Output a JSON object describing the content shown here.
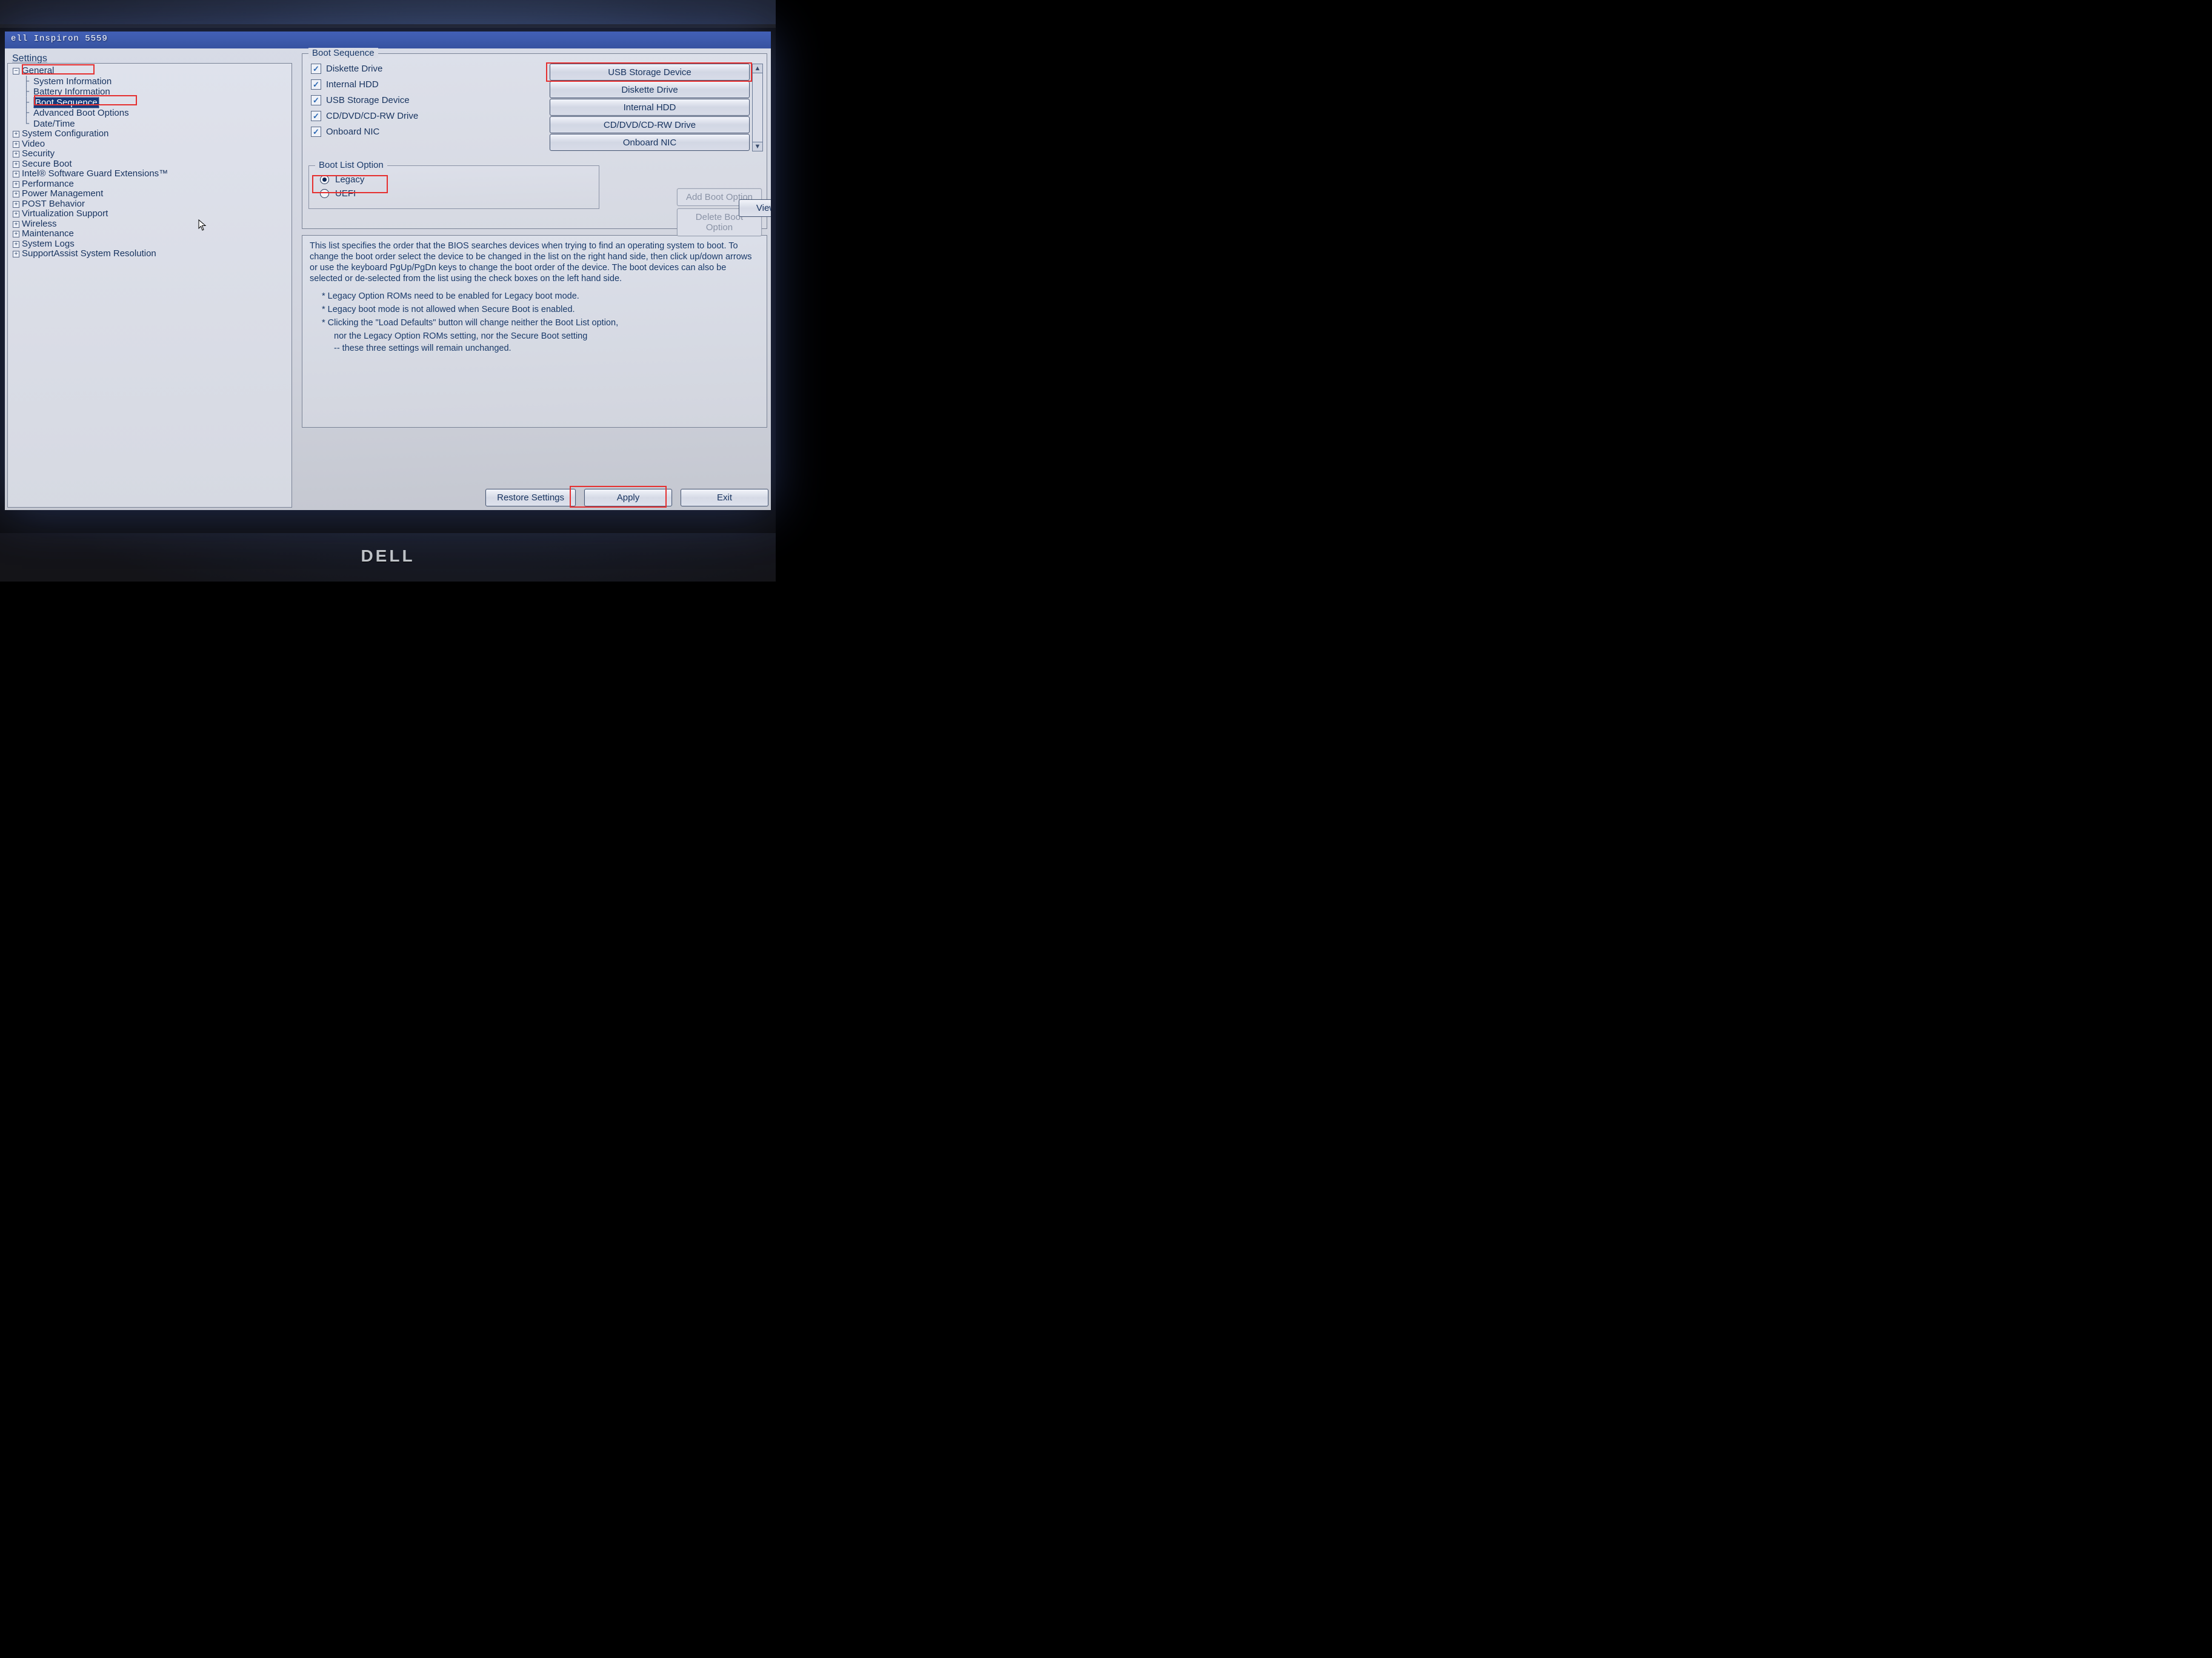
{
  "titlebar": "ell Inspiron 5559",
  "sidebar": {
    "header": "Settings",
    "tree": [
      {
        "label": "General",
        "expanded": true,
        "children": [
          "System Information",
          "Battery Information",
          "Boot Sequence",
          "Advanced Boot Options",
          "Date/Time"
        ],
        "selected_child_index": 2
      },
      {
        "label": "System Configuration",
        "expanded": false
      },
      {
        "label": "Video",
        "expanded": false
      },
      {
        "label": "Security",
        "expanded": false
      },
      {
        "label": "Secure Boot",
        "expanded": false
      },
      {
        "label": "Intel® Software Guard Extensions™",
        "expanded": false
      },
      {
        "label": "Performance",
        "expanded": false
      },
      {
        "label": "Power Management",
        "expanded": false
      },
      {
        "label": "POST Behavior",
        "expanded": false
      },
      {
        "label": "Virtualization Support",
        "expanded": false
      },
      {
        "label": "Wireless",
        "expanded": false
      },
      {
        "label": "Maintenance",
        "expanded": false
      },
      {
        "label": "System Logs",
        "expanded": false
      },
      {
        "label": "SupportAssist System Resolution",
        "expanded": false
      }
    ]
  },
  "boot_sequence": {
    "group_title": "Boot Sequence",
    "checks": [
      {
        "label": "Diskette Drive",
        "checked": true
      },
      {
        "label": "Internal HDD",
        "checked": true
      },
      {
        "label": "USB Storage Device",
        "checked": true
      },
      {
        "label": "CD/DVD/CD-RW Drive",
        "checked": true
      },
      {
        "label": "Onboard NIC",
        "checked": true
      }
    ],
    "order": [
      "USB Storage Device",
      "Diskette Drive",
      "Internal HDD",
      "CD/DVD/CD-RW Drive",
      "Onboard NIC"
    ]
  },
  "boot_list_option": {
    "group_title": "Boot List Option",
    "options": [
      {
        "label": "Legacy",
        "selected": true
      },
      {
        "label": "UEFI",
        "selected": false
      }
    ]
  },
  "side_buttons": {
    "add": "Add Boot Option",
    "delete": "Delete Boot Option",
    "view": "View"
  },
  "help": {
    "para1": "This list specifies the order that the BIOS searches devices when trying to find an operating system to boot. To change the boot order select the device to be changed in the list on the right hand side, then click up/down arrows or use the keyboard PgUp/PgDn keys to change the boot order of the device. The boot devices can also be selected or de-selected from the list using the check boxes on the left hand side.",
    "b1": "* Legacy Option ROMs need to be enabled for Legacy boot mode.",
    "b2": "* Legacy boot mode is not allowed when Secure Boot is enabled.",
    "b3": "* Clicking the \"Load Defaults\" button will change neither the Boot List option,",
    "b3a": "nor the Legacy Option ROMs setting, nor the Secure Boot setting",
    "b3b": "-- these three settings will remain unchanged."
  },
  "actions": {
    "restore": "Restore Settings",
    "apply": "Apply",
    "exit": "Exit"
  },
  "brand": "DELL"
}
